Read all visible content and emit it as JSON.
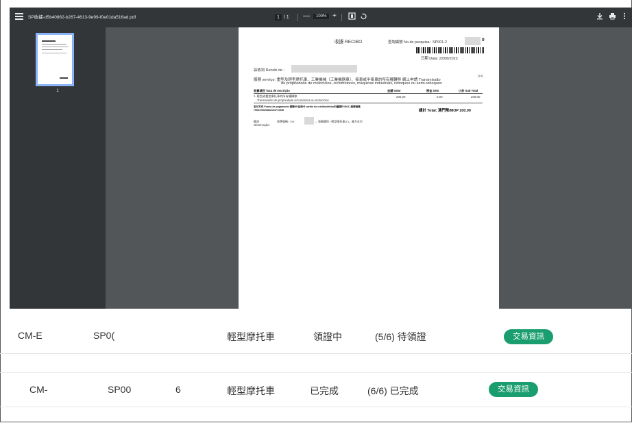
{
  "viewer": {
    "filename": "SP收據-d5b40862-b267-4613-9e99-f0e01da516ad.pdf",
    "page_current": "1",
    "page_total": "/ 1",
    "zoom": "100%",
    "zoom_out": "—",
    "zoom_in": "+",
    "thumbnail_page": "1"
  },
  "receipt": {
    "title": "收據 RECIBO",
    "query_label": "查詢編號 No.de pesquisa : SP001-2",
    "query_suffix": "0",
    "date": "日期 Data: 22/08/2023",
    "received_from": "茲收到 Recebi de :",
    "service_line1": "服務 serviço: 重型及輕型摩托車、工業機械（工業機器車）、掛車或半掛車的所有權轉移 網上申請 Transmissão",
    "service_line2": "de propriedade de motociclos, ciclomotores, máquinas industriais, reboques ou semi-reboques",
    "page_mark": "[1/1]",
    "col_item": "收費項目 Taxa de Inscrição",
    "col_value": "金額 Valor",
    "col_stamp": "税金 Selo",
    "col_subtotal": "小計 Sub Total",
    "item_line1": "1.  輕型或重型摩托車的所有權轉移",
    "item_line2": "Transmissão da propriedade ciclomotores ou motociclos",
    "item_value": "200.00",
    "item_stamp": "0.00",
    "item_subtotal": "200.00",
    "payment_line1": "支付方式 Forma de pagamento 銀聯卡/信用卡 cartão de crédito/débito中國銀行 BOC 憑單號碼",
    "payment_line2": "7905720020822104771545",
    "total": "總計 Total: 澳門幣/MOP 200.00",
    "remark_label": "備註 Observação:",
    "remark_text": "車牌號碼 / Chi",
    "remark_tail": "，車輛類別 / 輕型摩托車(C)，買方支付"
  },
  "table": {
    "rows": [
      {
        "id": "CM-E",
        "code": "SP0(",
        "qty": "",
        "vehicle": "輕型摩托車",
        "state": "領證中",
        "progress": "(5/6) 待領證",
        "action": "交易資訊"
      },
      {
        "id": "CM-",
        "code": "SP00",
        "qty": "6",
        "vehicle": "輕型摩托車",
        "state": "已完成",
        "progress": "(6/6) 已完成",
        "action": "交易資訊"
      }
    ]
  },
  "colors": {
    "accent_green": "#1a9e6f",
    "viewer_bg": "#525659",
    "toolbar_bg": "#323639",
    "thumb_border": "#8ab4f8"
  }
}
